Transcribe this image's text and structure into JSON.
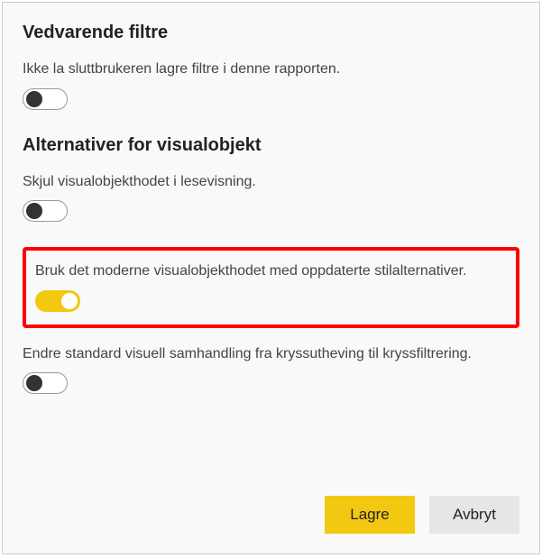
{
  "sections": {
    "persistent_filters": {
      "title": "Vedvarende filtre",
      "options": {
        "prevent_save_filters": {
          "label": "Ikke la sluttbrukeren lagre filtre i denne rapporten.",
          "on": false
        }
      }
    },
    "visual_options": {
      "title": "Alternativer for visualobjekt",
      "options": {
        "hide_visual_header": {
          "label": "Skjul visualobjekthodet i lesevisning.",
          "on": false
        },
        "modern_visual_header": {
          "label": "Bruk det moderne visualobjekthodet med oppdaterte stilalternativer.",
          "on": true
        },
        "cross_filtering": {
          "label": "Endre standard visuell samhandling fra kryssutheving til kryssfiltrering.",
          "on": false
        }
      }
    }
  },
  "footer": {
    "save": "Lagre",
    "cancel": "Avbryt"
  }
}
